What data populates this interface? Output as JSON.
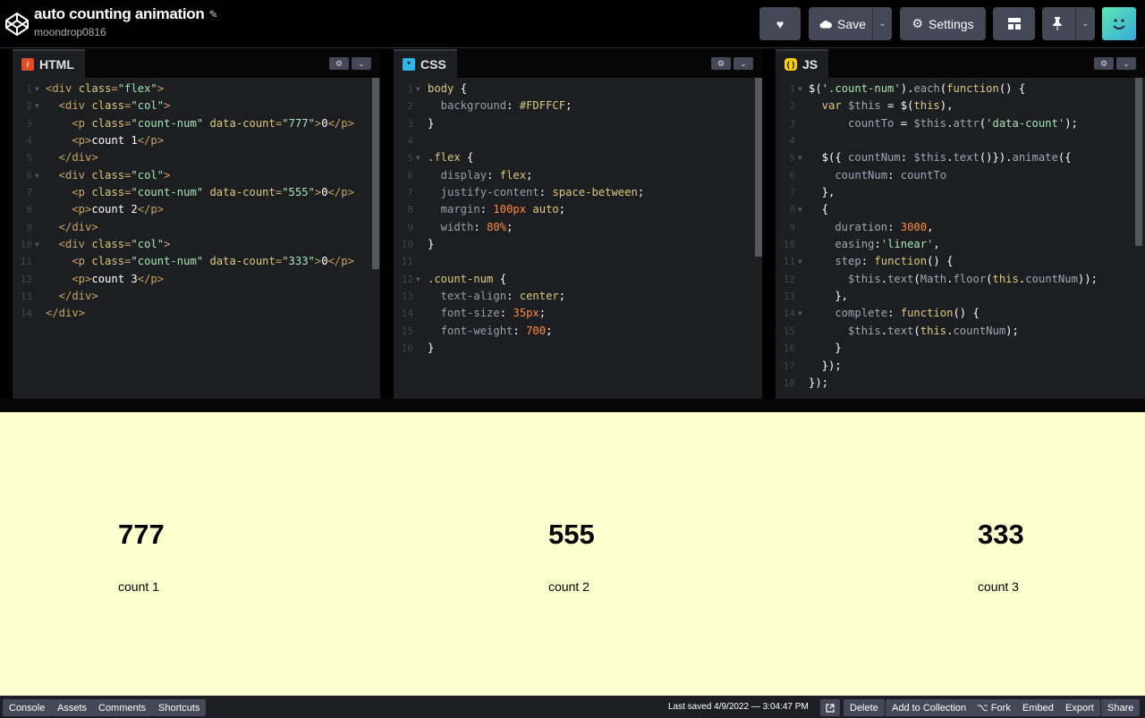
{
  "header": {
    "title": "auto counting animation",
    "user": "moondrop0816",
    "buttons": {
      "save": "Save",
      "settings": "Settings"
    }
  },
  "editors": {
    "html": {
      "tab": "HTML",
      "lines": [
        [
          [
            "t",
            "<div "
          ],
          [
            "an",
            "class"
          ],
          [
            "t",
            "="
          ],
          [
            "av",
            "\"flex\""
          ],
          [
            "t",
            ">"
          ]
        ],
        [
          [
            "t",
            "  <div "
          ],
          [
            "an",
            "class"
          ],
          [
            "t",
            "="
          ],
          [
            "av",
            "\"col\""
          ],
          [
            "t",
            ">"
          ]
        ],
        [
          [
            "t",
            "    <p "
          ],
          [
            "an",
            "class"
          ],
          [
            "t",
            "="
          ],
          [
            "av",
            "\"count-num\""
          ],
          [
            "tx",
            " "
          ],
          [
            "an",
            "data-count"
          ],
          [
            "t",
            "="
          ],
          [
            "av",
            "\"777\""
          ],
          [
            "t",
            ">"
          ],
          [
            "tx",
            "0"
          ],
          [
            "t",
            "</p>"
          ]
        ],
        [
          [
            "t",
            "    <p>"
          ],
          [
            "tx",
            "count 1"
          ],
          [
            "t",
            "</p>"
          ]
        ],
        [
          [
            "t",
            "  </div>"
          ]
        ],
        [
          [
            "t",
            "  <div "
          ],
          [
            "an",
            "class"
          ],
          [
            "t",
            "="
          ],
          [
            "av",
            "\"col\""
          ],
          [
            "t",
            ">"
          ]
        ],
        [
          [
            "t",
            "    <p "
          ],
          [
            "an",
            "class"
          ],
          [
            "t",
            "="
          ],
          [
            "av",
            "\"count-num\""
          ],
          [
            "tx",
            " "
          ],
          [
            "an",
            "data-count"
          ],
          [
            "t",
            "="
          ],
          [
            "av",
            "\"555\""
          ],
          [
            "t",
            ">"
          ],
          [
            "tx",
            "0"
          ],
          [
            "t",
            "</p>"
          ]
        ],
        [
          [
            "t",
            "    <p>"
          ],
          [
            "tx",
            "count 2"
          ],
          [
            "t",
            "</p>"
          ]
        ],
        [
          [
            "t",
            "  </div>"
          ]
        ],
        [
          [
            "t",
            "  <div "
          ],
          [
            "an",
            "class"
          ],
          [
            "t",
            "="
          ],
          [
            "av",
            "\"col\""
          ],
          [
            "t",
            ">"
          ]
        ],
        [
          [
            "t",
            "    <p "
          ],
          [
            "an",
            "class"
          ],
          [
            "t",
            "="
          ],
          [
            "av",
            "\"count-num\""
          ],
          [
            "tx",
            " "
          ],
          [
            "an",
            "data-count"
          ],
          [
            "t",
            "="
          ],
          [
            "av",
            "\"333\""
          ],
          [
            "t",
            ">"
          ],
          [
            "tx",
            "0"
          ],
          [
            "t",
            "</p>"
          ]
        ],
        [
          [
            "t",
            "    <p>"
          ],
          [
            "tx",
            "count 3"
          ],
          [
            "t",
            "</p>"
          ]
        ],
        [
          [
            "t",
            "  </div>"
          ]
        ],
        [
          [
            "t",
            "</div>"
          ]
        ]
      ]
    },
    "css": {
      "tab": "CSS",
      "lines": [
        [
          [
            "sel",
            "body"
          ],
          [
            "pn",
            " {"
          ]
        ],
        [
          [
            "pr",
            "  background"
          ],
          [
            "pn",
            ": "
          ],
          [
            "val",
            "#FDFFCF"
          ],
          [
            "pn",
            ";"
          ]
        ],
        [
          [
            "pn",
            "}"
          ]
        ],
        [],
        [
          [
            "sel",
            ".flex"
          ],
          [
            "pn",
            " {"
          ]
        ],
        [
          [
            "pr",
            "  display"
          ],
          [
            "pn",
            ": "
          ],
          [
            "val",
            "flex"
          ],
          [
            "pn",
            ";"
          ]
        ],
        [
          [
            "pr",
            "  justify-content"
          ],
          [
            "pn",
            ": "
          ],
          [
            "val",
            "space-between"
          ],
          [
            "pn",
            ";"
          ]
        ],
        [
          [
            "pr",
            "  margin"
          ],
          [
            "pn",
            ": "
          ],
          [
            "num",
            "100px"
          ],
          [
            "pn",
            " "
          ],
          [
            "val",
            "auto"
          ],
          [
            "pn",
            ";"
          ]
        ],
        [
          [
            "pr",
            "  width"
          ],
          [
            "pn",
            ": "
          ],
          [
            "num",
            "80%"
          ],
          [
            "pn",
            ";"
          ]
        ],
        [
          [
            "pn",
            "}"
          ]
        ],
        [],
        [
          [
            "sel",
            ".count-num"
          ],
          [
            "pn",
            " {"
          ]
        ],
        [
          [
            "pr",
            "  text-align"
          ],
          [
            "pn",
            ": "
          ],
          [
            "val",
            "center"
          ],
          [
            "pn",
            ";"
          ]
        ],
        [
          [
            "pr",
            "  font-size"
          ],
          [
            "pn",
            ": "
          ],
          [
            "num",
            "35px"
          ],
          [
            "pn",
            ";"
          ]
        ],
        [
          [
            "pr",
            "  font-weight"
          ],
          [
            "pn",
            ": "
          ],
          [
            "num",
            "700"
          ],
          [
            "pn",
            ";"
          ]
        ],
        [
          [
            "pn",
            "}"
          ]
        ]
      ]
    },
    "js": {
      "tab": "JS",
      "lines": [
        [
          [
            "pn",
            "$("
          ],
          [
            "str",
            "'.count-num'"
          ],
          [
            "pn",
            ")."
          ],
          [
            "jv",
            "each"
          ],
          [
            "pn",
            "("
          ],
          [
            "kw",
            "function"
          ],
          [
            "pn",
            "() {"
          ]
        ],
        [
          [
            "kw",
            "  var "
          ],
          [
            "jv",
            "$this"
          ],
          [
            "pn",
            " = $("
          ],
          [
            "kw",
            "this"
          ],
          [
            "pn",
            "),"
          ]
        ],
        [
          [
            "jv",
            "      countTo"
          ],
          [
            "pn",
            " = "
          ],
          [
            "jv",
            "$this"
          ],
          [
            "pn",
            "."
          ],
          [
            "jv",
            "attr"
          ],
          [
            "pn",
            "("
          ],
          [
            "str",
            "'data-count'"
          ],
          [
            "pn",
            ");"
          ]
        ],
        [],
        [
          [
            "pn",
            "  $({ "
          ],
          [
            "jv",
            "countNum"
          ],
          [
            "pn",
            ": "
          ],
          [
            "jv",
            "$this"
          ],
          [
            "pn",
            "."
          ],
          [
            "jv",
            "text"
          ],
          [
            "pn",
            "()})."
          ],
          [
            "jv",
            "animate"
          ],
          [
            "pn",
            "({"
          ]
        ],
        [
          [
            "jv",
            "    countNum"
          ],
          [
            "pn",
            ": "
          ],
          [
            "jv",
            "countTo"
          ]
        ],
        [
          [
            "pn",
            "  },"
          ]
        ],
        [
          [
            "pn",
            "  {"
          ]
        ],
        [
          [
            "jv",
            "    duration"
          ],
          [
            "pn",
            ": "
          ],
          [
            "num",
            "3000"
          ],
          [
            "pn",
            ","
          ]
        ],
        [
          [
            "jv",
            "    easing"
          ],
          [
            "pn",
            ":"
          ],
          [
            "str",
            "'linear'"
          ],
          [
            "pn",
            ","
          ]
        ],
        [
          [
            "jv",
            "    step"
          ],
          [
            "pn",
            ": "
          ],
          [
            "kw",
            "function"
          ],
          [
            "pn",
            "() {"
          ]
        ],
        [
          [
            "jv",
            "      $this"
          ],
          [
            "pn",
            "."
          ],
          [
            "jv",
            "text"
          ],
          [
            "pn",
            "("
          ],
          [
            "jv",
            "Math"
          ],
          [
            "pn",
            "."
          ],
          [
            "jv",
            "floor"
          ],
          [
            "pn",
            "("
          ],
          [
            "kw",
            "this"
          ],
          [
            "pn",
            "."
          ],
          [
            "jv",
            "countNum"
          ],
          [
            "pn",
            "));"
          ]
        ],
        [
          [
            "pn",
            "    },"
          ]
        ],
        [
          [
            "jv",
            "    complete"
          ],
          [
            "pn",
            ": "
          ],
          [
            "kw",
            "function"
          ],
          [
            "pn",
            "() {"
          ]
        ],
        [
          [
            "jv",
            "      $this"
          ],
          [
            "pn",
            "."
          ],
          [
            "jv",
            "text"
          ],
          [
            "pn",
            "("
          ],
          [
            "kw",
            "this"
          ],
          [
            "pn",
            "."
          ],
          [
            "jv",
            "countNum"
          ],
          [
            "pn",
            ");"
          ]
        ],
        [
          [
            "pn",
            "    }"
          ]
        ],
        [
          [
            "pn",
            "  });"
          ]
        ],
        [
          [
            "pn",
            "});"
          ]
        ]
      ]
    }
  },
  "preview": {
    "cols": [
      {
        "num": "777",
        "label": "count 1"
      },
      {
        "num": "555",
        "label": "count 2"
      },
      {
        "num": "333",
        "label": "count 3"
      }
    ]
  },
  "footer": {
    "left_buttons": [
      "Console",
      "Assets",
      "Comments",
      "Shortcuts"
    ],
    "last_saved": "Last saved 4/9/2022 — 3:04:47 PM",
    "right_buttons": [
      "Delete",
      "Add to Collection",
      "Fork",
      "Embed",
      "Export",
      "Share"
    ]
  }
}
